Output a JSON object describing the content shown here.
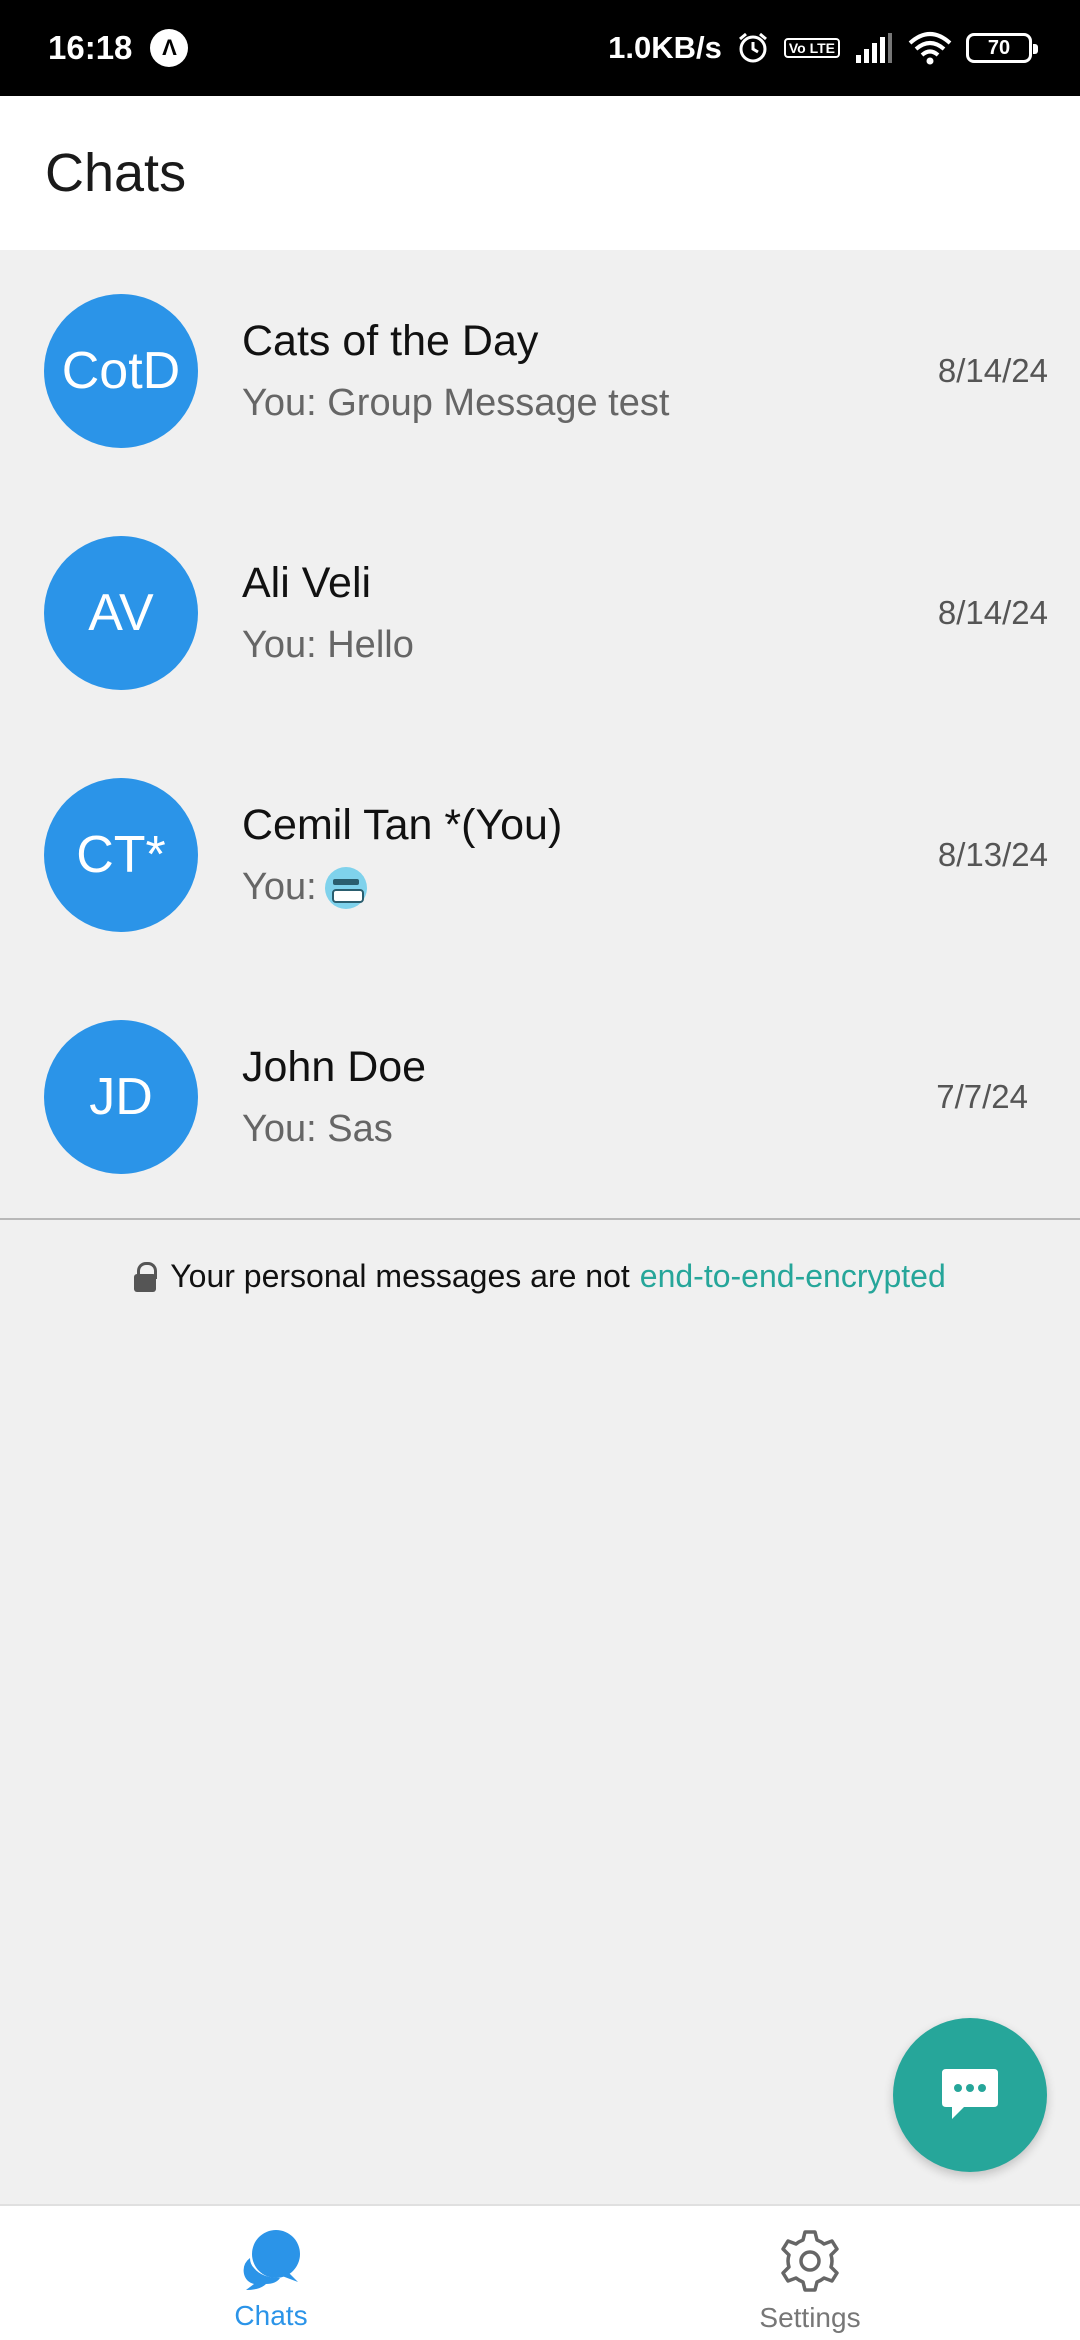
{
  "status_bar": {
    "time": "16:18",
    "nav_badge": "Λ",
    "network_speed": "1.0KB/s",
    "volte": "Vo LTE",
    "battery": "70"
  },
  "header": {
    "title": "Chats"
  },
  "chats": [
    {
      "initials": "CotD",
      "name": "Cats of the Day",
      "preview": "You: Group Message test",
      "date": "8/14/24"
    },
    {
      "initials": "AV",
      "name": "Ali Veli",
      "preview": "You: Hello",
      "date": "8/14/24"
    },
    {
      "initials": "CT*",
      "name": "Cemil Tan *(You)",
      "preview": "You:",
      "date": "8/13/24",
      "emoji": "cold-face-emoji"
    },
    {
      "initials": "JD",
      "name": "John Doe",
      "preview": "You: Sas",
      "date": "7/7/24"
    }
  ],
  "encryption_note": {
    "text": "Your personal messages are not",
    "link": "end-to-end-encrypted"
  },
  "fab": {
    "icon": "new-message-icon"
  },
  "bottom_nav": {
    "items": [
      {
        "label": "Chats",
        "icon": "chat-bubbles-icon",
        "active": true
      },
      {
        "label": "Settings",
        "icon": "gear-icon",
        "active": false
      }
    ]
  },
  "colors": {
    "avatar": "#2b94e8",
    "accent": "#26a69a",
    "active_tab": "#2b94e8"
  }
}
